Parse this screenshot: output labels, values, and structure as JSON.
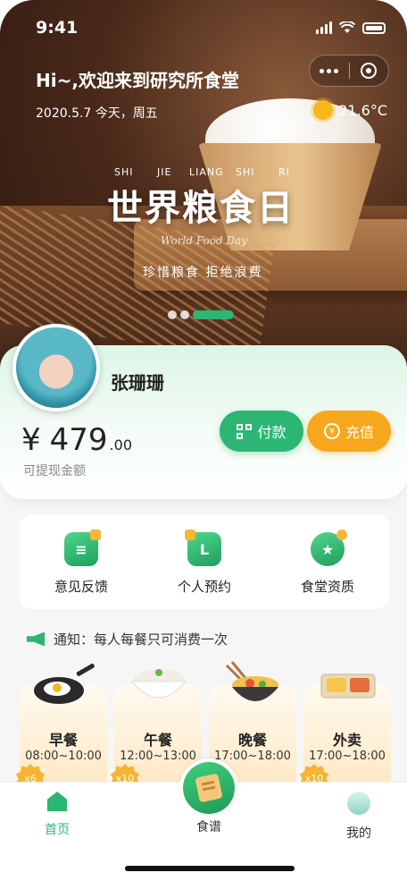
{
  "status_bar": {
    "time": "9:41"
  },
  "banner": {
    "greeting": "Hi~,欢迎来到研究所食堂",
    "date_text": "2020.5.7   今天，周五",
    "temperature": "21.6°C",
    "pinyin": [
      "SHI",
      "JIE",
      "LIANG",
      "SHI",
      "RI"
    ],
    "festival_title": "世界粮食日",
    "festival_en": "World Food Day",
    "slogan": "珍惜粮食 拒绝浪费",
    "pager_total": 3,
    "pager_active": 3
  },
  "wallet": {
    "user_name": "张珊珊",
    "currency": "¥",
    "amount_int": "479",
    "amount_dec": ".00",
    "amount_label": "可提现金额",
    "pay_label": "付款",
    "topup_label": "充值",
    "colors": {
      "pay": "#2bb673",
      "topup": "#f7a71c"
    }
  },
  "quick_actions": [
    {
      "label": "意见反馈",
      "icon": "feedback-icon"
    },
    {
      "label": "个人预约",
      "icon": "reservation-icon"
    },
    {
      "label": "食堂资质",
      "icon": "qualification-icon"
    }
  ],
  "notice": {
    "text": "通知：每人每餐只可消费一次"
  },
  "meals": [
    {
      "name": "早餐",
      "time": "08:00~10:00",
      "badge": "x6",
      "icon": "fried-egg-icon"
    },
    {
      "name": "午餐",
      "time": "12:00~13:00",
      "badge": "x10",
      "icon": "rice-bowl-icon"
    },
    {
      "name": "晚餐",
      "time": "17:00~18:00",
      "badge": "x10",
      "icon": "noodle-bowl-icon"
    },
    {
      "name": "外卖",
      "time": "17:00~18:00",
      "badge": "x10",
      "icon": "takeout-box-icon"
    }
  ],
  "tabbar": {
    "home": "首页",
    "menu": "食谱",
    "me": "我的",
    "accent": "#2bb673"
  }
}
